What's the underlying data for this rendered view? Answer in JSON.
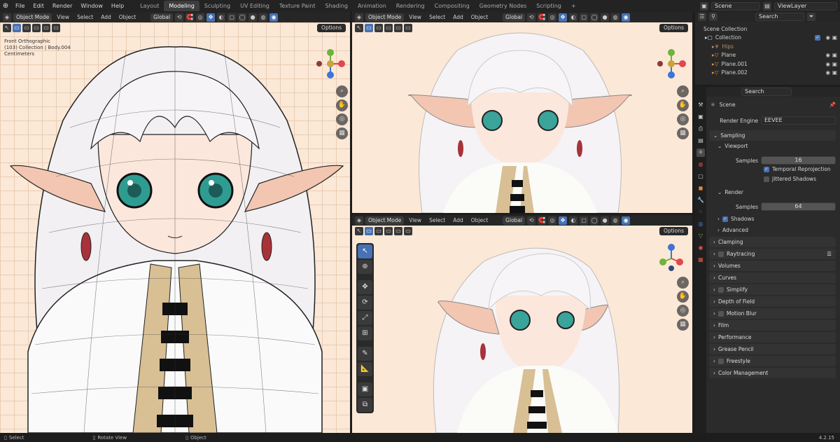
{
  "menubar": {
    "items": [
      "File",
      "Edit",
      "Render",
      "Window",
      "Help"
    ],
    "workspaces": [
      "Layout",
      "Modeling",
      "Sculpting",
      "UV Editing",
      "Texture Paint",
      "Shading",
      "Animation",
      "Rendering",
      "Compositing",
      "Geometry Nodes",
      "Scripting"
    ],
    "active_workspace": "Modeling",
    "add_tab": "+",
    "scene_field": "Scene",
    "viewlayer_field": "ViewLayer"
  },
  "viewport_header": {
    "mode": "Object Mode",
    "menus": [
      "View",
      "Select",
      "Add",
      "Object"
    ],
    "orientation": "Global",
    "options": "Options"
  },
  "main_viewport": {
    "overlay": [
      "Front Orthographic",
      "(103) Collection | Body.004",
      "Centimeters"
    ]
  },
  "outliner": {
    "search_placeholder": "Search",
    "scene_collection": "Scene Collection",
    "collection": "Collection",
    "items": [
      "Hips",
      "Plane",
      "Plane.001",
      "Plane.002"
    ]
  },
  "properties": {
    "search_placeholder": "Search",
    "context": "Scene",
    "render_engine_label": "Render Engine",
    "render_engine_value": "EEVEE",
    "sampling": "Sampling",
    "viewport": "Viewport",
    "samples_label": "Samples",
    "viewport_samples": "16",
    "temporal_reprojection": "Temporal Reprojection",
    "jittered_shadows": "Jittered Shadows",
    "render": "Render",
    "render_samples": "64",
    "shadows": "Shadows",
    "advanced": "Advanced",
    "panels": [
      "Clamping",
      "Raytracing",
      "Volumes",
      "Curves",
      "Simplify",
      "Depth of Field",
      "Motion Blur",
      "Film",
      "Performance",
      "Grease Pencil",
      "Freestyle",
      "Color Management"
    ]
  },
  "statusbar": {
    "select": "Select",
    "rotate": "Rotate View",
    "object": "Object",
    "version": "4.2.15"
  },
  "colors": {
    "accent": "#4772b3",
    "viewport_bg": "#fce8d6",
    "axis_x": "#e0484f",
    "axis_y": "#6cb43a",
    "axis_z": "#3d74d6"
  }
}
